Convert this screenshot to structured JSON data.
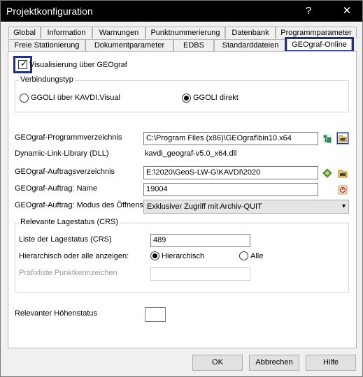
{
  "window": {
    "title": "Projektkonfiguration",
    "help_glyph": "?",
    "close_glyph": "✕"
  },
  "tabs_row1": [
    "Global",
    "Information",
    "Warnungen",
    "Punktnummerierung",
    "Datenbank",
    "Programmparameter"
  ],
  "tabs_row2": [
    "Freie Stationierung",
    "Dokumentparameter",
    "EDBS",
    "Standarddateien",
    "GEOgraf-Online"
  ],
  "active_tab": "GEOgraf-Online",
  "visualisierung": {
    "label": "Visualisierung über GEOgraf",
    "checked": true
  },
  "verbindungstyp": {
    "title": "Verbindungstyp",
    "options": [
      "GGOLI über KAVDI.Visual",
      "GGOLI direkt"
    ],
    "selected": "GGOLI direkt"
  },
  "fields": {
    "programmverzeichnis": {
      "label": "GEOgraf-Programmverzeichnis",
      "value": "C:\\Program Files (x86)\\GEOgraf\\bin10.x64"
    },
    "dll": {
      "label": "Dynamic-Link-Library (DLL)",
      "value": "kavdi_geograf-v5.0_x64.dll"
    },
    "auftragsverzeichnis": {
      "label": "GEOgraf-Auftragsverzeichnis",
      "value": "E:\\2020\\GeoS-LW-G\\KAVDI\\2020"
    },
    "auftrag_name": {
      "label": "GEOgraf-Auftrag: Name",
      "value": "19004"
    },
    "modus": {
      "label": "GEOgraf-Auftrag: Modus des Öffnens",
      "value": "Exklusiver Zugriff mit Archiv-QUIT"
    }
  },
  "lagestatus": {
    "title": "Relevante Lagestatus (CRS)",
    "liste_label": "Liste der Lagestatus (CRS)",
    "liste_value": "489",
    "anzeigen_label": "Hierarchisch oder alle anzeigen:",
    "options": [
      "Hierarchisch",
      "Alle"
    ],
    "selected": "Hierarchisch",
    "praefix_label": "Präfixliste Punktkennzeichen",
    "praefix_value": ""
  },
  "hoehenstatus": {
    "label": "Relevanter Höhenstatus",
    "value": ""
  },
  "buttons": {
    "ok": "OK",
    "abbrechen": "Abbrechen",
    "hilfe": "Hilfe"
  },
  "colors": {
    "highlight": "#1e2f8e",
    "titlebar": "#000000"
  }
}
